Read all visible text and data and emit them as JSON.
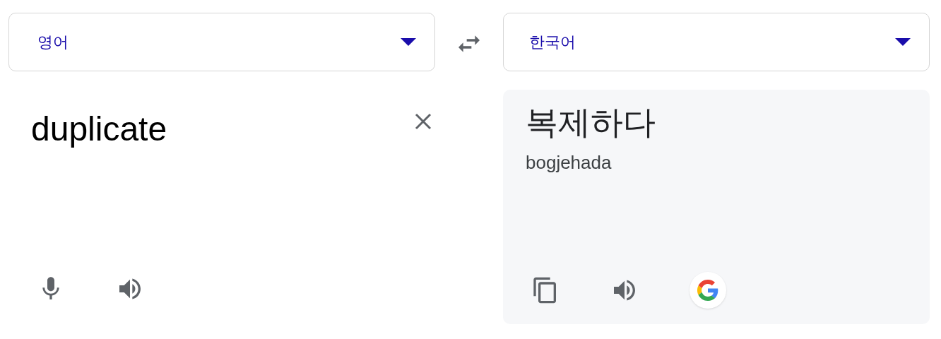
{
  "source_language": {
    "label": "영어"
  },
  "target_language": {
    "label": "한국어"
  },
  "source": {
    "value": "duplicate"
  },
  "result": {
    "text": "복제하다",
    "romanization": "bogjehada"
  }
}
